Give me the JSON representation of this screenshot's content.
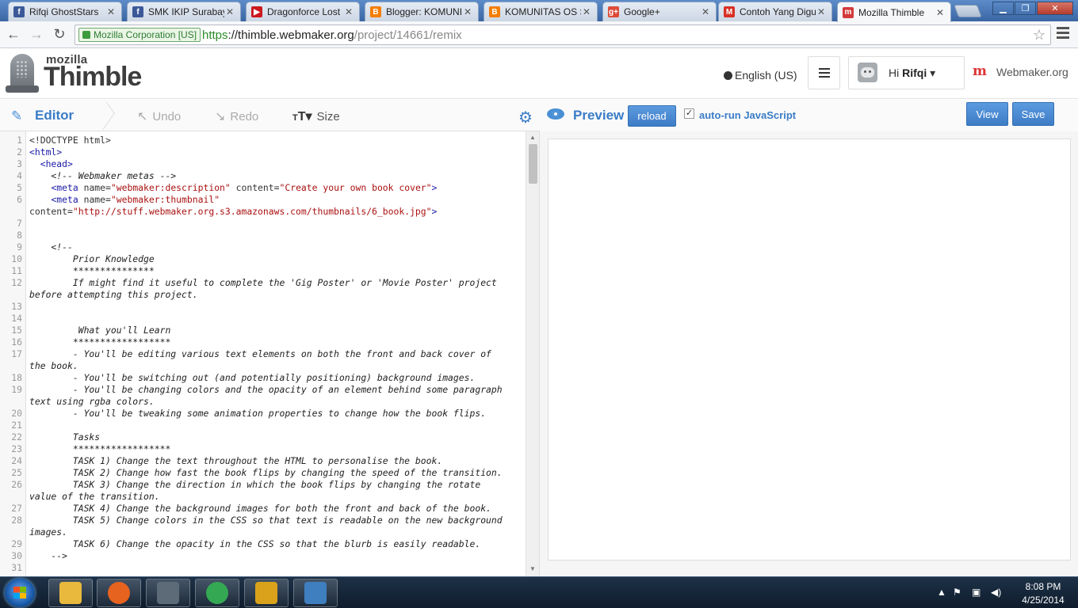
{
  "browser": {
    "tabs": [
      {
        "label": "Rifqi GhostStars",
        "favicon": "facebook-icon",
        "color": "#3b5998",
        "glyph": "f"
      },
      {
        "label": "SMK IKIP Surabaya",
        "favicon": "facebook-icon",
        "color": "#3b5998",
        "glyph": "f"
      },
      {
        "label": "Dragonforce Lost",
        "favicon": "youtube-icon",
        "color": "#cc181e",
        "glyph": "▶"
      },
      {
        "label": "Blogger: KOMUNI",
        "favicon": "blogger-icon",
        "color": "#f57d00",
        "glyph": "B"
      },
      {
        "label": "KOMUNITAS OS S",
        "favicon": "blogger-icon",
        "color": "#f57d00",
        "glyph": "B"
      },
      {
        "label": "Google+",
        "favicon": "google-plus-icon",
        "color": "#dd4b39",
        "glyph": "g+"
      },
      {
        "label": "Contoh Yang Digu",
        "favicon": "gmail-icon",
        "color": "#d93025",
        "glyph": "M"
      },
      {
        "label": "Mozilla Thimble",
        "favicon": "webmaker-icon",
        "color": "#d33a3a",
        "glyph": "m"
      }
    ],
    "ev_badge": "Mozilla Corporation [US]",
    "url_scheme": "https",
    "url_host": "://thimble.webmaker.org",
    "url_path": "/project/14661/remix"
  },
  "header": {
    "logo_top": "mozilla",
    "logo_name": "Thimble",
    "language": "English (US)",
    "greeting": "Hi ",
    "username": "Rifqi",
    "webmaker": "Webmaker.org"
  },
  "editor": {
    "tab_label": "Editor",
    "undo": "Undo",
    "redo": "Redo",
    "size": "Size",
    "lines": [
      {
        "n": "1",
        "t": "<!DOCTYPE html>",
        "k": "plain"
      },
      {
        "n": "2",
        "t": "<html>",
        "k": "tag"
      },
      {
        "n": "3",
        "t": "  <head>",
        "k": "tag"
      },
      {
        "n": "4",
        "t": "    <!-- Webmaker metas -->",
        "k": "cmt"
      },
      {
        "n": "5",
        "t": "    <meta name=\"webmaker:description\" content=\"Create your own book cover\">",
        "k": "meta"
      },
      {
        "n": "6",
        "t": "    <meta name=\"webmaker:thumbnail\"",
        "k": "meta"
      },
      {
        "n": "",
        "t": "content=\"http://stuff.webmaker.org.s3.amazonaws.com/thumbnails/6_book.jpg\">",
        "k": "meta"
      },
      {
        "n": "7",
        "t": "",
        "k": "plain"
      },
      {
        "n": "8",
        "t": "",
        "k": "plain"
      },
      {
        "n": "9",
        "t": "    <!--",
        "k": "cmt"
      },
      {
        "n": "10",
        "t": "        Prior Knowledge",
        "k": "cmt"
      },
      {
        "n": "11",
        "t": "        ***************",
        "k": "cmt"
      },
      {
        "n": "12",
        "t": "        If might find it useful to complete the 'Gig Poster' or 'Movie Poster' project",
        "k": "cmt"
      },
      {
        "n": "",
        "t": "before attempting this project.",
        "k": "cmt"
      },
      {
        "n": "13",
        "t": "",
        "k": "plain"
      },
      {
        "n": "14",
        "t": "",
        "k": "plain"
      },
      {
        "n": "15",
        "t": "         What you'll Learn",
        "k": "cmt"
      },
      {
        "n": "16",
        "t": "        ******************",
        "k": "cmt"
      },
      {
        "n": "17",
        "t": "        - You'll be editing various text elements on both the front and back cover of",
        "k": "cmt"
      },
      {
        "n": "",
        "t": "the book.",
        "k": "cmt"
      },
      {
        "n": "18",
        "t": "        - You'll be switching out (and potentially positioning) background images.",
        "k": "cmt"
      },
      {
        "n": "19",
        "t": "        - You'll be changing colors and the opacity of an element behind some paragraph",
        "k": "cmt"
      },
      {
        "n": "",
        "t": "text using rgba colors.",
        "k": "cmt"
      },
      {
        "n": "20",
        "t": "        - You'll be tweaking some animation properties to change how the book flips.",
        "k": "cmt"
      },
      {
        "n": "21",
        "t": "",
        "k": "plain"
      },
      {
        "n": "22",
        "t": "        Tasks",
        "k": "cmt"
      },
      {
        "n": "23",
        "t": "        ******************",
        "k": "cmt"
      },
      {
        "n": "24",
        "t": "        TASK 1) Change the text throughout the HTML to personalise the book.",
        "k": "cmt"
      },
      {
        "n": "25",
        "t": "        TASK 2) Change how fast the book flips by changing the speed of the transition.",
        "k": "cmt"
      },
      {
        "n": "26",
        "t": "        TASK 3) Change the direction in which the book flips by changing the rotate",
        "k": "cmt"
      },
      {
        "n": "",
        "t": "value of the transition.",
        "k": "cmt"
      },
      {
        "n": "27",
        "t": "        TASK 4) Change the background images for both the front and back of the book.",
        "k": "cmt"
      },
      {
        "n": "28",
        "t": "        TASK 5) Change colors in the CSS so that text is readable on the new background",
        "k": "cmt"
      },
      {
        "n": "",
        "t": "images.",
        "k": "cmt"
      },
      {
        "n": "29",
        "t": "        TASK 6) Change the opacity in the CSS so that the blurb is easily readable.",
        "k": "cmt"
      },
      {
        "n": "30",
        "t": "    -->",
        "k": "cmt"
      },
      {
        "n": "31",
        "t": "",
        "k": "plain"
      }
    ]
  },
  "preview": {
    "label": "Preview",
    "reload": "reload",
    "autorun_label": "auto-run JavaScript",
    "autorun_checked": true,
    "view": "View",
    "save": "Save"
  },
  "taskbar": {
    "apps": [
      {
        "name": "explorer-icon",
        "color": "#e8b93c"
      },
      {
        "name": "firefox-icon",
        "color": "#e6621f"
      },
      {
        "name": "computer-icon",
        "color": "#5d6b78"
      },
      {
        "name": "chrome-icon",
        "color": "#34a853"
      },
      {
        "name": "winamp-icon",
        "color": "#d9a21a"
      },
      {
        "name": "photo-viewer-icon",
        "color": "#3f7fbf"
      }
    ],
    "time": "8:08 PM",
    "date": "4/25/2014"
  }
}
